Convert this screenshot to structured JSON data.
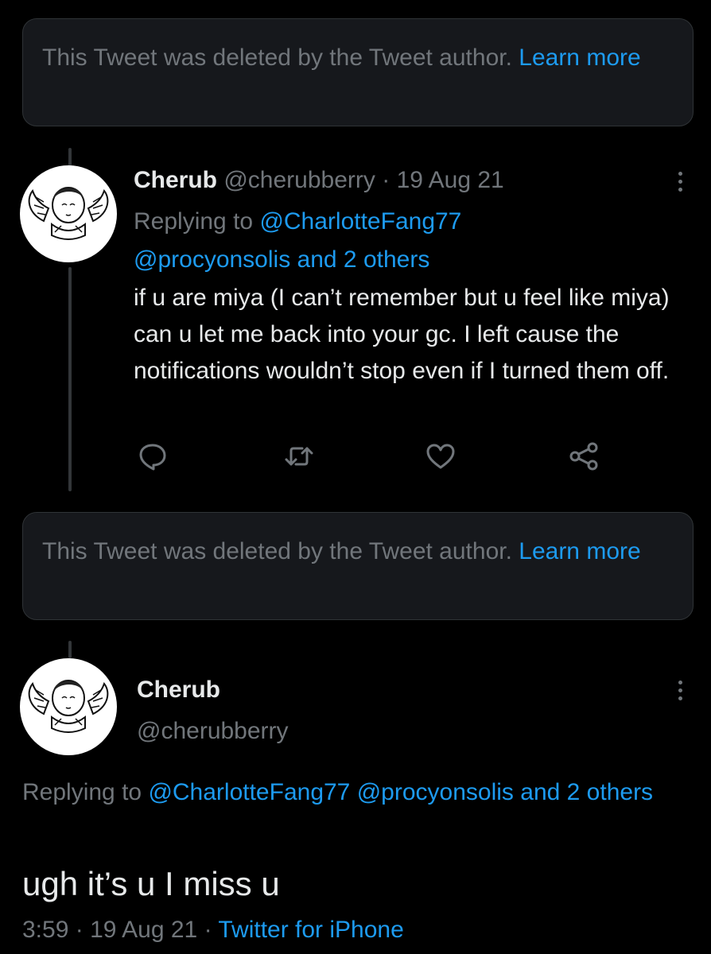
{
  "colors": {
    "background": "#000000",
    "notice_background": "#16181c",
    "primary_text": "#e7e9ea",
    "secondary_text": "#71767b",
    "accent": "#1d9bf0"
  },
  "deleted_notice_1": {
    "text": "This Tweet was deleted by the Tweet author.",
    "link": "Learn more"
  },
  "tweet_1": {
    "avatar_icon": "cherub-avatar",
    "name": "Cherub",
    "handle": "@cherubberry",
    "separator": "·",
    "date": "19 Aug 21",
    "replying_prefix": "Replying to",
    "mention_1": "@CharlotteFang77",
    "mention_2": "@procyonsolis",
    "and_others": "and 2 others",
    "body": "if u are miya (I can’t remember but u feel like miya) can u let me back into your gc. I left cause the notifications wouldn’t stop even if I turned them off.",
    "actions": [
      "reply-icon",
      "retweet-icon",
      "like-icon",
      "share-icon"
    ],
    "more_icon": "more-options-icon"
  },
  "deleted_notice_2": {
    "text": "This Tweet was deleted by the Tweet author.",
    "link": "Learn more"
  },
  "tweet_2": {
    "avatar_icon": "cherub-avatar",
    "name": "Cherub",
    "handle": "@cherubberry",
    "replying_prefix": "Replying to",
    "mention_1": "@CharlotteFang77",
    "mention_2": "@procyonsolis",
    "and_others": "and 2 others",
    "body": "ugh it’s u I miss u",
    "time": "3:59",
    "separator": "·",
    "date": "19 Aug 21",
    "source": "Twitter for iPhone",
    "more_icon": "more-options-icon"
  }
}
